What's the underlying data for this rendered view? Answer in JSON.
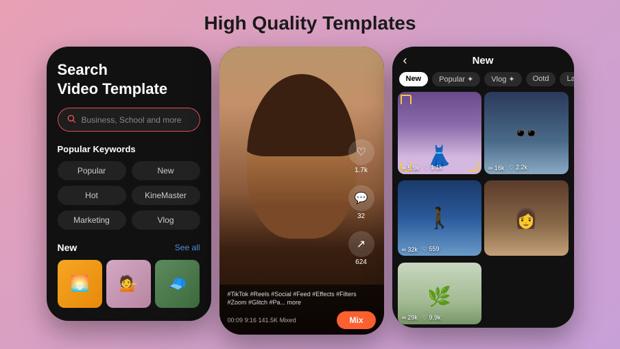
{
  "page": {
    "title": "High Quality Templates",
    "background": "linear-gradient(135deg, #e8a0b4, #d4a0c8, #c8a0d8)"
  },
  "phone1": {
    "search_title": "Search\nVideo Template",
    "search_placeholder": "Business, School and more",
    "popular_title": "Popular Keywords",
    "keywords": [
      {
        "label": "Popular"
      },
      {
        "label": "New"
      },
      {
        "label": "Hot"
      },
      {
        "label": "KineMaster"
      },
      {
        "label": "Marketing"
      },
      {
        "label": "Vlog"
      }
    ],
    "new_label": "New",
    "see_all_label": "See all"
  },
  "phone2": {
    "hashtags": "#TikTok #Reels #Social #Feed\n#Effects #Filters #Zoom #Glitch #Pa...\nmore",
    "time_info": "00:09   9:16  141.5K Mixed",
    "mix_label": "Mix",
    "like_count": "1.7k",
    "comment_count": "32",
    "share_count": "624"
  },
  "phone3": {
    "back_label": "‹",
    "title": "New",
    "tabs": [
      {
        "label": "New",
        "active": true
      },
      {
        "label": "Popular ✦",
        "active": false
      },
      {
        "label": "Vlog ✦",
        "active": false
      },
      {
        "label": "Ootd",
        "active": false
      },
      {
        "label": "Lab",
        "active": false
      }
    ],
    "cards": [
      {
        "type": "purple-girl",
        "stats": {
          "plays": "5.9k",
          "likes": "1.1k"
        },
        "has_frame": true
      },
      {
        "type": "sunglasses-girl",
        "stats": {
          "plays": "16k",
          "likes": "2.2k"
        }
      },
      {
        "type": "blue-silhouette",
        "stats": {
          "plays": "32k",
          "likes": "559"
        }
      },
      {
        "type": "brown-girl",
        "stats": {
          "plays": "",
          "likes": ""
        }
      },
      {
        "type": "plants-hands",
        "stats": {
          "plays": "29k",
          "likes": "9.9k"
        }
      }
    ]
  }
}
